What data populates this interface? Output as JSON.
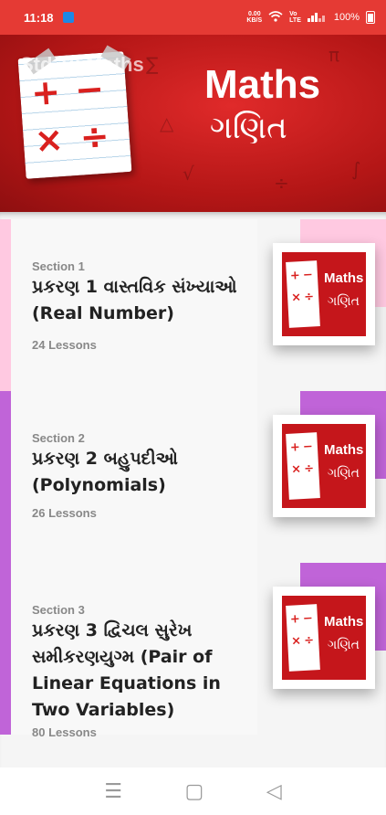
{
  "status_bar": {
    "time": "11:18",
    "net_speed_value": "0.00",
    "net_speed_unit": "KB/S",
    "battery": "100%",
    "icons": [
      "usb-icon",
      "wifi-icon",
      "volte-icon",
      "signal-icon",
      "battery-icon"
    ]
  },
  "header": {
    "back_title": "Std 10 Maths",
    "banner_title_en": "Maths",
    "banner_title_gu": "ગણિત",
    "symbols": [
      "+",
      "−",
      "×",
      "÷"
    ]
  },
  "sections": [
    {
      "section_label": "Section 1",
      "title": "પ્રકરણ 1 વાસ્તવિક સંખ્યાઓ (Real Number)",
      "lessons": "24 Lessons",
      "stripe_color": "#ffc9e1",
      "accent_color": "#ffc9e1",
      "thumb_en": "Maths",
      "thumb_gu": "ગણિત"
    },
    {
      "section_label": "Section 2",
      "title": "પ્રકરણ 2 બહુપદીઓ (Polynomials)",
      "lessons": "26 Lessons",
      "stripe_color": "#c064d8",
      "accent_color": "#c064d8",
      "thumb_en": "Maths",
      "thumb_gu": "ગણિત"
    },
    {
      "section_label": "Section 3",
      "title": "પ્રકરણ 3 દ્વિચલ સુરેખ સમીકરણયુગ્મ (Pair of Linear Equations in Two Variables)",
      "lessons": "80 Lessons",
      "stripe_color": "#c064d8",
      "accent_color": "#c064d8",
      "thumb_en": "Maths",
      "thumb_gu": "ગણિત"
    }
  ],
  "nav_bar": {
    "menu_glyph": "☰",
    "home_glyph": "▢",
    "back_glyph": "◁"
  }
}
